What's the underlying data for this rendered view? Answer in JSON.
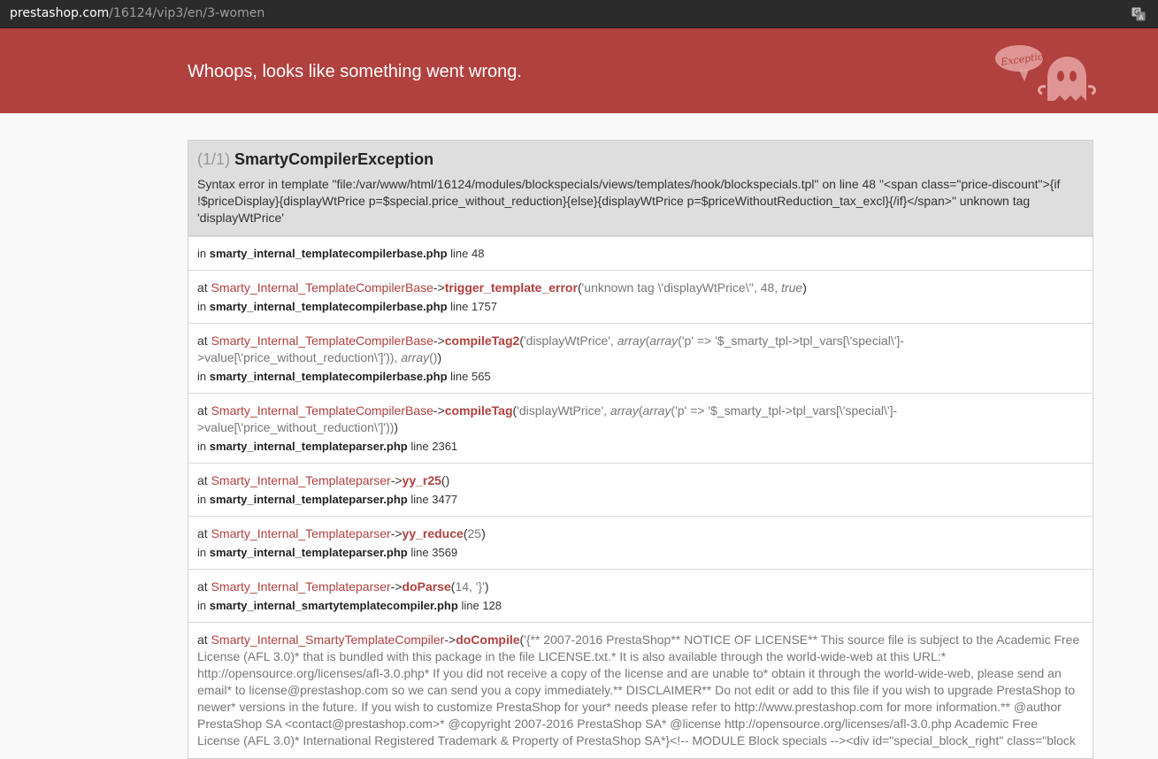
{
  "browser": {
    "url_host": "prestashop.com",
    "url_path": "/16124/vip3/en/3-women"
  },
  "header": {
    "title": "Whoops, looks like something went wrong.",
    "logo_text": "Exception!"
  },
  "exception": {
    "count": "(1/1)",
    "name": "SmartyCompilerException",
    "message": "Syntax error in template \"file:/var/www/html/16124/modules/blockspecials/views/templates/hook/blockspecials.tpl\" on line 48 \"<span class=\"price-discount\">{if !$priceDisplay}{displayWtPrice p=$special.price_without_reduction}{else}{displayWtPrice p=$priceWithoutReduction_tax_excl}{/if}</span>\" unknown tag 'displayWtPrice'"
  },
  "labels": {
    "at": "at",
    "in": "in",
    "line": "line",
    "arrow": "->"
  },
  "frames": [
    {
      "file": "smarty_internal_templatecompilerbase.php",
      "line": "48"
    },
    {
      "class": "Smarty_Internal_TemplateCompilerBase",
      "method": "trigger_template_error",
      "open": "(",
      "args_a": "'unknown tag \\'displayWtPrice\\'', 48, ",
      "args_italic": "true",
      "close": ")",
      "file": "smarty_internal_templatecompilerbase.php",
      "line": "1757"
    },
    {
      "class": "Smarty_Internal_TemplateCompilerBase",
      "method": "compileTag2",
      "open": "(",
      "args_a": "'displayWtPrice', ",
      "args_i1": "array",
      "args_b": "(",
      "args_i2": "array",
      "args_c": "('p' => '$_smarty_tpl->tpl_vars[\\'special\\']->value[\\'price_without_reduction\\']')), ",
      "args_i3": "array",
      "args_d": "()",
      "close": ")",
      "file": "smarty_internal_templatecompilerbase.php",
      "line": "565"
    },
    {
      "class": "Smarty_Internal_TemplateCompilerBase",
      "method": "compileTag",
      "open": "(",
      "args_a": "'displayWtPrice', ",
      "args_i1": "array",
      "args_b": "(",
      "args_i2": "array",
      "args_c": "('p' => '$_smarty_tpl->tpl_vars[\\'special\\']->value[\\'price_without_reduction\\']'))",
      "close": ")",
      "file": "smarty_internal_templateparser.php",
      "line": "2361"
    },
    {
      "class": "Smarty_Internal_Templateparser",
      "method": "yy_r25",
      "open": "(",
      "close": ")",
      "file": "smarty_internal_templateparser.php",
      "line": "3477"
    },
    {
      "class": "Smarty_Internal_Templateparser",
      "method": "yy_reduce",
      "open": "(",
      "args_a": "25",
      "close": ")",
      "file": "smarty_internal_templateparser.php",
      "line": "3569"
    },
    {
      "class": "Smarty_Internal_Templateparser",
      "method": "doParse",
      "open": "(",
      "args_a": "14, '}'",
      "close": ")",
      "file": "smarty_internal_smartytemplatecompiler.php",
      "line": "128"
    },
    {
      "class": "Smarty_Internal_SmartyTemplateCompiler",
      "method": "doCompile",
      "open": "(",
      "args_a": "'{** 2007-2016 PrestaShop** NOTICE OF LICENSE** This source file is subject to the Academic Free License (AFL 3.0)* that is bundled with this package in the file LICENSE.txt.* It is also available through the world-wide-web at this URL:* http://opensource.org/licenses/afl-3.0.php* If you did not receive a copy of the license and are unable to* obtain it through the world-wide-web, please send an email* to license@prestashop.com so we can send you a copy immediately.** DISCLAIMER** Do not edit or add to this file if you wish to upgrade PrestaShop to newer* versions in the future. If you wish to customize PrestaShop for your* needs please refer to http://www.prestashop.com for more information.** @author PrestaShop SA <contact@prestashop.com>* @copyright 2007-2016 PrestaShop SA* @license http://opensource.org/licenses/afl-3.0.php Academic Free License (AFL 3.0)* International Registered Trademark & Property of PrestaShop SA*}<!-- MODULE Block specials --><div id=\"special_block_right\" class=\"block"
    }
  ],
  "colors": {
    "header_bg": "#b0413e",
    "accent": "#b0413e",
    "panel_head_bg": "#dedede"
  },
  "icons": [
    "translate-icon",
    "ghost-exception-logo"
  ]
}
